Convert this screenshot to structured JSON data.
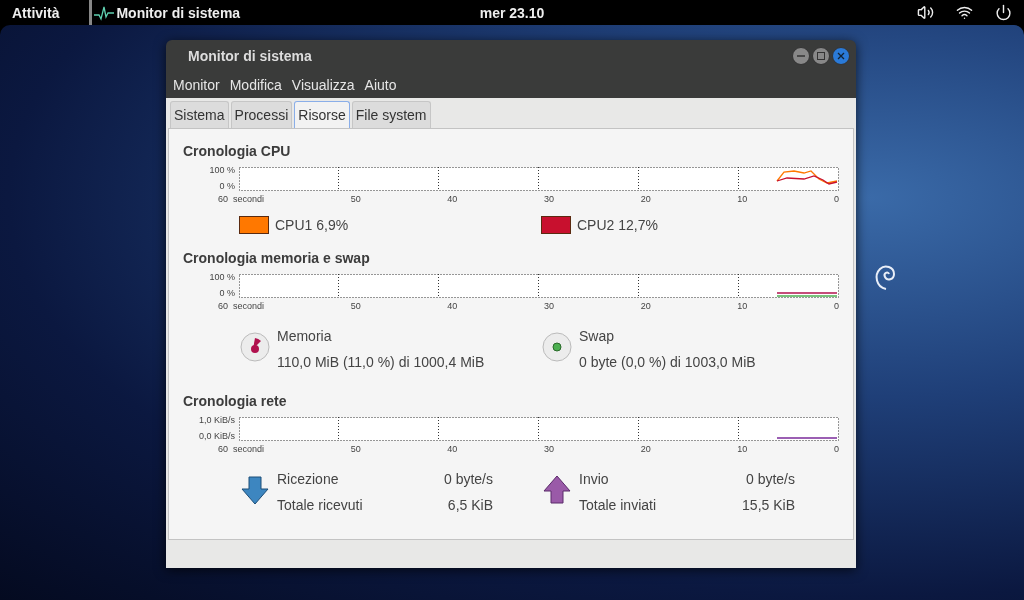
{
  "top_bar": {
    "activities": "Attività",
    "app_name": "Monitor di sistema",
    "clock": "mer 23.10"
  },
  "window": {
    "title": "Monitor di sistema",
    "menu": [
      "Monitor",
      "Modifica",
      "Visualizza",
      "Aiuto"
    ],
    "tabs": [
      {
        "label": "Sistema",
        "selected": false
      },
      {
        "label": "Processi",
        "selected": false
      },
      {
        "label": "Risorse",
        "selected": true
      },
      {
        "label": "File system",
        "selected": false
      }
    ],
    "cpu": {
      "title": "Cronologia CPU",
      "y_labels": [
        "100 %",
        "0 %"
      ],
      "x_labels": [
        "60  secondi",
        "50",
        "40",
        "30",
        "20",
        "10",
        "0"
      ],
      "legend": [
        {
          "label": "CPU1 6,9%",
          "color": "#ff7800"
        },
        {
          "label": "CPU2 12,7%",
          "color": "#c8102e"
        }
      ]
    },
    "memory": {
      "title": "Cronologia memoria e swap",
      "y_labels": [
        "100 %",
        "0 %"
      ],
      "x_labels": [
        "60  secondi",
        "50",
        "40",
        "30",
        "20",
        "10",
        "0"
      ],
      "items": [
        {
          "kind": "memory",
          "label": "Memoria",
          "value": "110,0 MiB (11,0 %) di 1000,4 MiB"
        },
        {
          "kind": "swap",
          "label": "Swap",
          "value": "0 byte (0,0 %) di 1003,0 MiB"
        }
      ]
    },
    "network": {
      "title": "Cronologia rete",
      "y_labels": [
        "1,0 KiB/s",
        "0,0 KiB/s"
      ],
      "x_labels": [
        "60  secondi",
        "50",
        "40",
        "30",
        "20",
        "10",
        "0"
      ],
      "items": [
        {
          "kind": "receive",
          "rate_label": "Ricezione",
          "rate": "0 byte/s",
          "total_label": "Totale ricevuti",
          "total": "6,5 KiB"
        },
        {
          "kind": "send",
          "rate_label": "Invio",
          "rate": "0 byte/s",
          "total_label": "Totale inviati",
          "total": "15,5 KiB"
        }
      ]
    }
  }
}
